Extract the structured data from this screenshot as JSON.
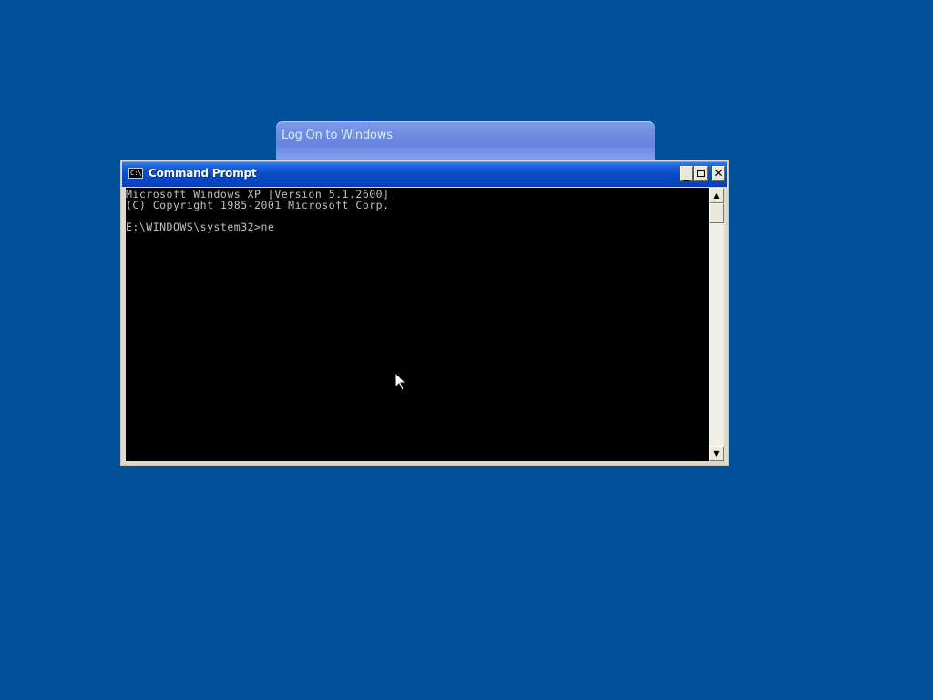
{
  "logon_dialog": {
    "title": "Log On to Windows"
  },
  "cmd_window": {
    "title": "Command Prompt",
    "icon_label": "C:\\",
    "buttons": {
      "minimize": "_",
      "close": "✕"
    },
    "console_lines": [
      "Microsoft Windows XP [Version 5.1.2600]",
      "(C) Copyright 1985-2001 Microsoft Corp.",
      "",
      "E:\\WINDOWS\\system32>ne"
    ]
  },
  "scrollbar": {
    "up_arrow": "▲",
    "down_arrow": "▼"
  },
  "colors": {
    "desktop_background": "#02509c",
    "titlebar_blue": "#0645c0",
    "console_background": "#000000",
    "console_text": "#c0c0c0"
  },
  "icons": [
    "cmd-app-icon",
    "minimize-icon",
    "maximize-icon",
    "close-icon",
    "scroll-up-arrow-icon",
    "scroll-down-arrow-icon",
    "mouse-pointer-icon"
  ]
}
